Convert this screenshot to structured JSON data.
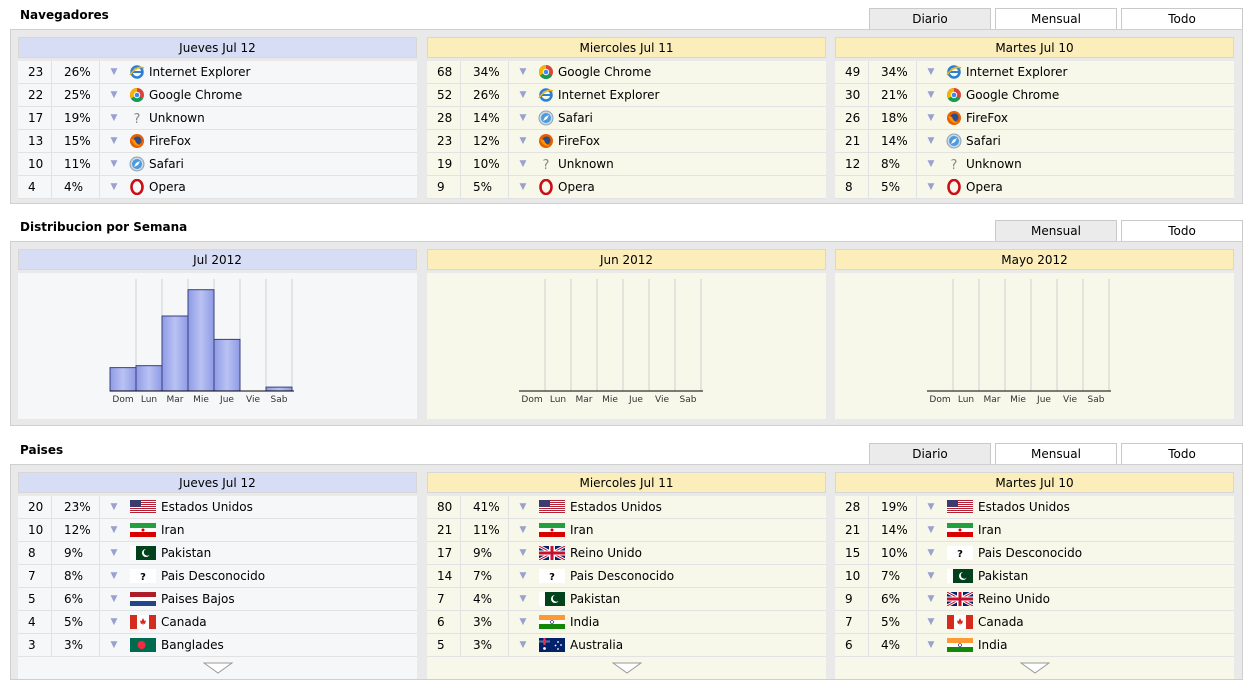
{
  "navegadores": {
    "title": "Navegadores",
    "tabs": [
      "Diario",
      "Mensual",
      "Todo"
    ],
    "columns": [
      {
        "header": "Jueves Jul 12",
        "theme": "blue",
        "rows": [
          {
            "count": "23",
            "pct": "26%",
            "icon": "ie-icon",
            "name": "Internet Explorer"
          },
          {
            "count": "22",
            "pct": "25%",
            "icon": "chrome-icon",
            "name": "Google Chrome"
          },
          {
            "count": "17",
            "pct": "19%",
            "icon": "unknown-icon",
            "name": "Unknown"
          },
          {
            "count": "13",
            "pct": "15%",
            "icon": "firefox-icon",
            "name": "FireFox"
          },
          {
            "count": "10",
            "pct": "11%",
            "icon": "safari-icon",
            "name": "Safari"
          },
          {
            "count": "4",
            "pct": "4%",
            "icon": "opera-icon",
            "name": "Opera"
          }
        ]
      },
      {
        "header": "Miercoles Jul 11",
        "theme": "yellow",
        "rows": [
          {
            "count": "68",
            "pct": "34%",
            "icon": "chrome-icon",
            "name": "Google Chrome"
          },
          {
            "count": "52",
            "pct": "26%",
            "icon": "ie-icon",
            "name": "Internet Explorer"
          },
          {
            "count": "28",
            "pct": "14%",
            "icon": "safari-icon",
            "name": "Safari"
          },
          {
            "count": "23",
            "pct": "12%",
            "icon": "firefox-icon",
            "name": "FireFox"
          },
          {
            "count": "19",
            "pct": "10%",
            "icon": "unknown-icon",
            "name": "Unknown"
          },
          {
            "count": "9",
            "pct": "5%",
            "icon": "opera-icon",
            "name": "Opera"
          }
        ]
      },
      {
        "header": "Martes Jul 10",
        "theme": "yellow",
        "rows": [
          {
            "count": "49",
            "pct": "34%",
            "icon": "ie-icon",
            "name": "Internet Explorer"
          },
          {
            "count": "30",
            "pct": "21%",
            "icon": "chrome-icon",
            "name": "Google Chrome"
          },
          {
            "count": "26",
            "pct": "18%",
            "icon": "firefox-icon",
            "name": "FireFox"
          },
          {
            "count": "21",
            "pct": "14%",
            "icon": "safari-icon",
            "name": "Safari"
          },
          {
            "count": "12",
            "pct": "8%",
            "icon": "unknown-icon",
            "name": "Unknown"
          },
          {
            "count": "8",
            "pct": "5%",
            "icon": "opera-icon",
            "name": "Opera"
          }
        ]
      }
    ]
  },
  "distribucion": {
    "title": "Distribucion por Semana",
    "tabs": [
      "Mensual",
      "Todo"
    ],
    "columns": [
      {
        "header": "Jul 2012",
        "theme": "blue"
      },
      {
        "header": "Jun 2012",
        "theme": "yellow"
      },
      {
        "header": "Mayo 2012",
        "theme": "yellow"
      }
    ]
  },
  "chart_data": [
    {
      "type": "bar",
      "categories": [
        "Dom",
        "Lun",
        "Mar",
        "Mie",
        "Jue",
        "Vie",
        "Sab"
      ],
      "values": [
        24,
        26,
        77,
        104,
        53,
        0,
        4
      ],
      "ylim": [
        0,
        115
      ],
      "grid": true,
      "color": "#8e9be6"
    },
    {
      "type": "bar",
      "categories": [
        "Dom",
        "Lun",
        "Mar",
        "Mie",
        "Jue",
        "Vie",
        "Sab"
      ],
      "values": [
        0,
        0,
        0,
        0,
        0,
        0,
        0
      ],
      "ylim": [
        0,
        115
      ],
      "grid": true,
      "color": "#8e9be6"
    },
    {
      "type": "bar",
      "categories": [
        "Dom",
        "Lun",
        "Mar",
        "Mie",
        "Jue",
        "Vie",
        "Sab"
      ],
      "values": [
        0,
        0,
        0,
        0,
        0,
        0,
        0
      ],
      "ylim": [
        0,
        115
      ],
      "grid": true,
      "color": "#8e9be6"
    }
  ],
  "paises": {
    "title": "Paises",
    "tabs": [
      "Diario",
      "Mensual",
      "Todo"
    ],
    "columns": [
      {
        "header": "Jueves Jul 12",
        "theme": "blue",
        "rows": [
          {
            "count": "20",
            "pct": "23%",
            "icon": "flag-us-icon",
            "name": "Estados Unidos"
          },
          {
            "count": "10",
            "pct": "12%",
            "icon": "flag-ir-icon",
            "name": "Iran"
          },
          {
            "count": "8",
            "pct": "9%",
            "icon": "flag-pk-icon",
            "name": "Pakistan"
          },
          {
            "count": "7",
            "pct": "8%",
            "icon": "flag-unknown-icon",
            "name": "Pais Desconocido"
          },
          {
            "count": "5",
            "pct": "6%",
            "icon": "flag-nl-icon",
            "name": "Paises Bajos"
          },
          {
            "count": "4",
            "pct": "5%",
            "icon": "flag-ca-icon",
            "name": "Canada"
          },
          {
            "count": "3",
            "pct": "3%",
            "icon": "flag-bd-icon",
            "name": "Banglades"
          }
        ]
      },
      {
        "header": "Miercoles Jul 11",
        "theme": "yellow",
        "rows": [
          {
            "count": "80",
            "pct": "41%",
            "icon": "flag-us-icon",
            "name": "Estados Unidos"
          },
          {
            "count": "21",
            "pct": "11%",
            "icon": "flag-ir-icon",
            "name": "Iran"
          },
          {
            "count": "17",
            "pct": "9%",
            "icon": "flag-gb-icon",
            "name": "Reino Unido"
          },
          {
            "count": "14",
            "pct": "7%",
            "icon": "flag-unknown-icon",
            "name": "Pais Desconocido"
          },
          {
            "count": "7",
            "pct": "4%",
            "icon": "flag-pk-icon",
            "name": "Pakistan"
          },
          {
            "count": "6",
            "pct": "3%",
            "icon": "flag-in-icon",
            "name": "India"
          },
          {
            "count": "5",
            "pct": "3%",
            "icon": "flag-au-icon",
            "name": "Australia"
          }
        ]
      },
      {
        "header": "Martes Jul 10",
        "theme": "yellow",
        "rows": [
          {
            "count": "28",
            "pct": "19%",
            "icon": "flag-us-icon",
            "name": "Estados Unidos"
          },
          {
            "count": "21",
            "pct": "14%",
            "icon": "flag-ir-icon",
            "name": "Iran"
          },
          {
            "count": "15",
            "pct": "10%",
            "icon": "flag-unknown-icon",
            "name": "Pais Desconocido"
          },
          {
            "count": "10",
            "pct": "7%",
            "icon": "flag-pk-icon",
            "name": "Pakistan"
          },
          {
            "count": "9",
            "pct": "6%",
            "icon": "flag-gb-icon",
            "name": "Reino Unido"
          },
          {
            "count": "7",
            "pct": "5%",
            "icon": "flag-ca-icon",
            "name": "Canada"
          },
          {
            "count": "6",
            "pct": "4%",
            "icon": "flag-in-icon",
            "name": "India"
          }
        ]
      }
    ]
  },
  "colors": {
    "blue_header": "#d8ddf6",
    "yellow_header": "#fbeebb",
    "bar": "#8e9be6",
    "active_tab": "#ebebeb"
  }
}
